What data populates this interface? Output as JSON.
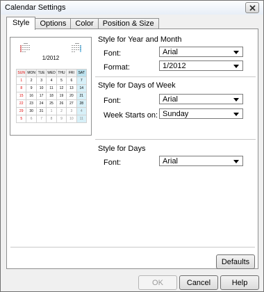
{
  "window": {
    "title": "Calendar Settings"
  },
  "tabs": [
    {
      "label": "Style",
      "active": true
    },
    {
      "label": "Options",
      "active": false
    },
    {
      "label": "Color",
      "active": false
    },
    {
      "label": "Position & Size",
      "active": false
    }
  ],
  "preview": {
    "title": "1/2012",
    "weekdays": [
      "SUN",
      "MON",
      "TUE",
      "WED",
      "THU",
      "FRI",
      "SAT"
    ],
    "weeks": [
      [
        "1",
        "2",
        "3",
        "4",
        "5",
        "6",
        "7"
      ],
      [
        "8",
        "9",
        "10",
        "11",
        "12",
        "13",
        "14"
      ],
      [
        "15",
        "16",
        "17",
        "18",
        "19",
        "20",
        "21"
      ],
      [
        "22",
        "23",
        "24",
        "25",
        "26",
        "27",
        "28"
      ],
      [
        "29",
        "30",
        "31",
        "1",
        "2",
        "3",
        "4"
      ],
      [
        "5",
        "6",
        "7",
        "8",
        "9",
        "10",
        "11"
      ]
    ]
  },
  "year_month": {
    "heading": "Style for Year and Month",
    "font_label": "Font:",
    "font_value": "Arial",
    "format_label": "Format:",
    "format_value": "1/2012"
  },
  "days_of_week": {
    "heading": "Style for Days of Week",
    "font_label": "Font:",
    "font_value": "Arial",
    "week_starts_label": "Week Starts on:",
    "week_starts_value": "Sunday"
  },
  "days": {
    "heading": "Style for Days",
    "font_label": "Font:",
    "font_value": "Arial"
  },
  "buttons": {
    "defaults": "Defaults",
    "ok": "OK",
    "cancel": "Cancel",
    "help": "Help"
  }
}
